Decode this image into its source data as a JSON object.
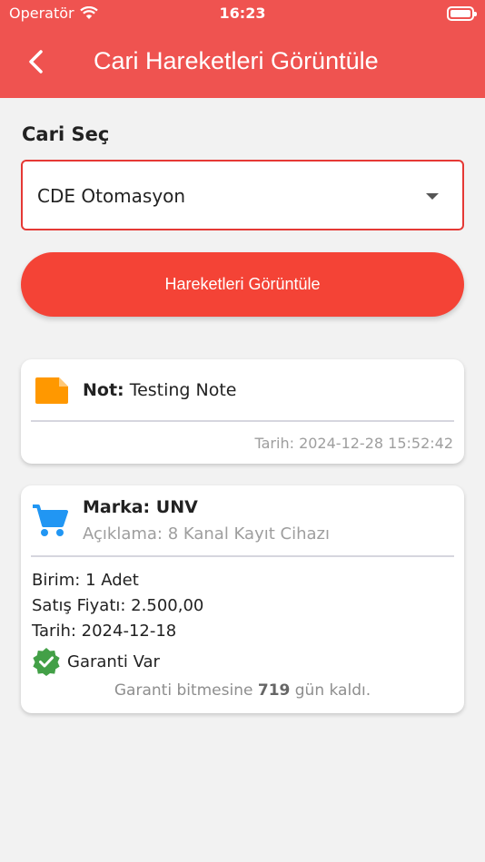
{
  "status_bar": {
    "carrier": "Operatör",
    "time": "16:23"
  },
  "app_bar": {
    "title": "Cari Hareketleri Görüntüle"
  },
  "form": {
    "label": "Cari Seç",
    "selected_value": "CDE Otomasyon",
    "button_label": "Hareketleri Görüntüle"
  },
  "note_card": {
    "label": "Not:",
    "text": "Testing Note",
    "date": "Tarih: 2024-12-28 15:52:42"
  },
  "sale_card": {
    "brand": "Marka: UNV",
    "description": "Açıklama: 8 Kanal Kayıt Cihazı",
    "unit": "Birim: 1 Adet",
    "price": "Satış Fiyatı: 2.500,00",
    "date": "Tarih: 2024-12-18",
    "warranty": "Garanti Var",
    "remaining_prefix": "Garanti bitmesine",
    "remaining_days": "719",
    "remaining_suffix": "gün kaldı."
  },
  "colors": {
    "app_bar": "#ef5350",
    "button": "#f44336",
    "select_border": "#e53935",
    "note_icon": "#ff9800",
    "cart_icon": "#2196f3",
    "warranty_icon": "#43a047"
  }
}
